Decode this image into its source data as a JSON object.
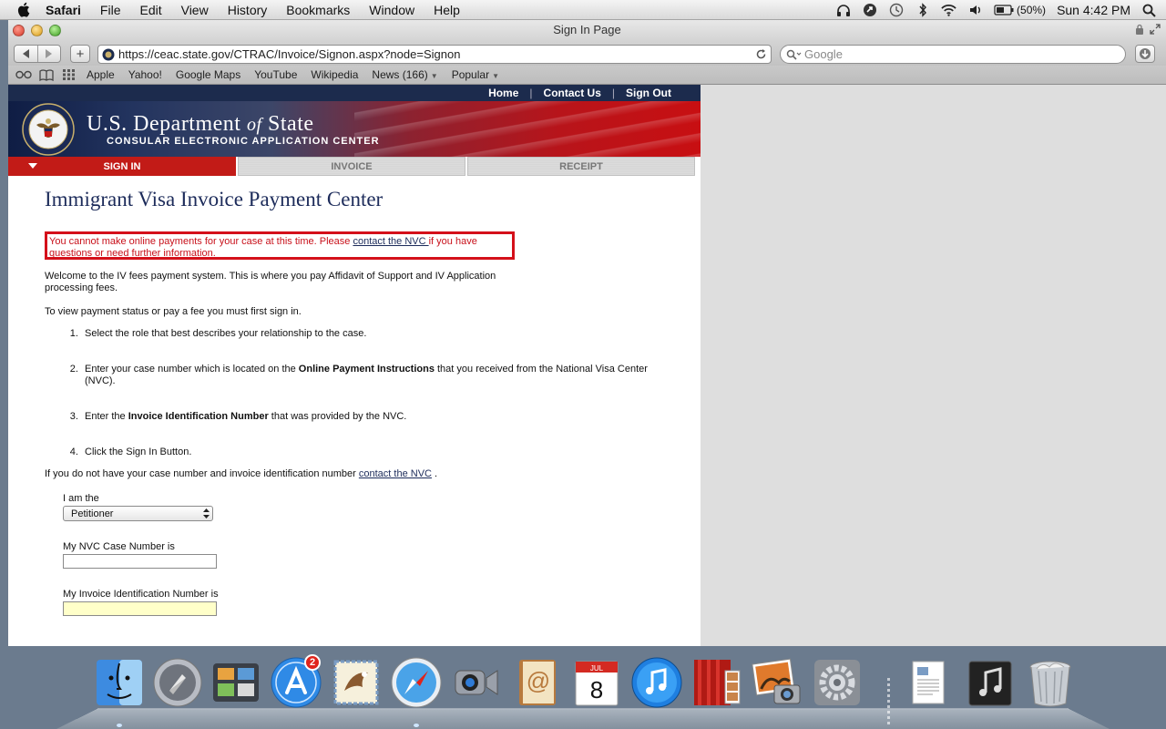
{
  "menubar": {
    "app": "Safari",
    "items": [
      "File",
      "Edit",
      "View",
      "History",
      "Bookmarks",
      "Window",
      "Help"
    ],
    "battery": "(50%)",
    "clock": "Sun 4:42 PM"
  },
  "window": {
    "title": "Sign In Page"
  },
  "toolbar": {
    "url": "https://ceac.state.gov/CTRAC/Invoice/Signon.aspx?node=Signon",
    "search_placeholder": "Google"
  },
  "bookmarks": {
    "items": [
      "Apple",
      "Yahoo!",
      "Google Maps",
      "YouTube",
      "Wikipedia",
      "News (166)",
      "Popular"
    ]
  },
  "site": {
    "topnav": [
      "Home",
      "Contact Us",
      "Sign Out"
    ],
    "banner": {
      "dept_pre": "U.S. Department ",
      "dept_of": "of",
      "dept_post": " State",
      "subtitle": "CONSULAR ELECTRONIC APPLICATION CENTER"
    },
    "tabs": [
      "SIGN IN",
      "INVOICE",
      "RECEIPT"
    ],
    "title": "Immigrant Visa Invoice Payment Center",
    "error": {
      "pre": "You cannot make online payments for your case at this time. Please ",
      "link": "contact the NVC ",
      "post": "if you have questions or need further information."
    },
    "welcome": "Welcome to the IV fees payment system. This is where you pay Affidavit of Support and IV Application processing fees.",
    "to_view": "To view payment status or pay a fee you must first sign in.",
    "steps": {
      "s1": "Select the role that best describes your relationship to the case.",
      "s2_pre": "Enter your case number which is located on the ",
      "s2_bold": "Online Payment Instructions",
      "s2_post": " that you received from the National Visa Center (NVC).",
      "s3_pre": "Enter the ",
      "s3_bold": "Invoice Identification Number",
      "s3_post": " that was provided by the NVC.",
      "s4": "Click the Sign In Button."
    },
    "no_case": {
      "pre": "If you do not have your case number and invoice identification number ",
      "link": "contact the NVC",
      "post": " ."
    },
    "form": {
      "role_label": "I am the",
      "role_value": "Petitioner",
      "case_label": "My NVC Case Number is",
      "case_value": "",
      "invoice_label": "My Invoice Identification Number is",
      "invoice_value": ""
    }
  },
  "dock": {
    "appstore_badge": "2",
    "calendar_month": "JUL",
    "calendar_day": "8"
  }
}
